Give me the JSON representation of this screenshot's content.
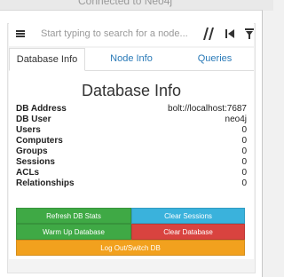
{
  "window": {
    "title_fragment": "Connected to Neo4j"
  },
  "search": {
    "placeholder": "Start typing to search for a node..."
  },
  "toolbar": {
    "icons": [
      "menu-icon",
      "path-icon",
      "back-icon",
      "filter-icon"
    ]
  },
  "tabs": [
    {
      "label": "Database Info",
      "active": true
    },
    {
      "label": "Node Info",
      "active": false
    },
    {
      "label": "Queries",
      "active": false
    }
  ],
  "main": {
    "title": "Database Info",
    "rows": [
      {
        "label": "DB Address",
        "value": "bolt://localhost:7687"
      },
      {
        "label": "DB User",
        "value": "neo4j"
      },
      {
        "label": "Users",
        "value": "0"
      },
      {
        "label": "Computers",
        "value": "0"
      },
      {
        "label": "Groups",
        "value": "0"
      },
      {
        "label": "Sessions",
        "value": "0"
      },
      {
        "label": "ACLs",
        "value": "0"
      },
      {
        "label": "Relationships",
        "value": "0"
      }
    ]
  },
  "buttons": {
    "refresh": "Refresh DB Stats",
    "clear_sessions": "Clear Sessions",
    "warm_up": "Warm Up Database",
    "clear_database": "Clear Database",
    "logout": "Log Out/Switch DB"
  },
  "colors": {
    "green": "#3fa945",
    "blue": "#3ab2dc",
    "red": "#d9433f",
    "orange": "#f2a11e",
    "link": "#2a7ab8"
  }
}
